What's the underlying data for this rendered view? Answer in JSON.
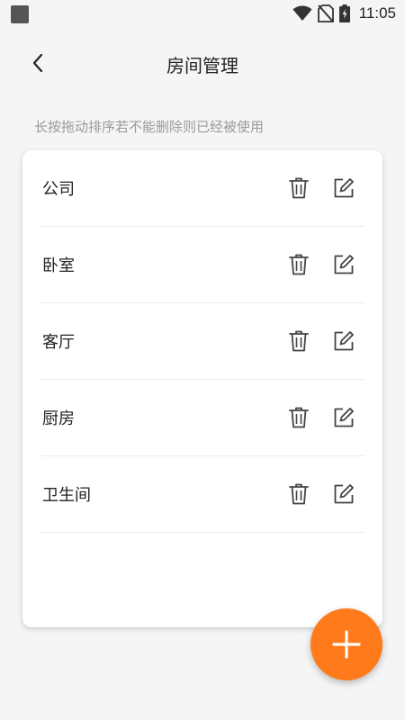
{
  "status_bar": {
    "time": "11:05",
    "icons": [
      "app-notification-icon",
      "wifi-icon",
      "no-sim-icon",
      "battery-charging-icon"
    ]
  },
  "header": {
    "title": "房间管理",
    "back_icon": "chevron-left-icon"
  },
  "hint": "长按拖动排序若不能删除则已经被使用",
  "rooms": [
    {
      "name": "公司"
    },
    {
      "name": "卧室"
    },
    {
      "name": "客厅"
    },
    {
      "name": "厨房"
    },
    {
      "name": "卫生间"
    }
  ],
  "row_actions": [
    "trash-icon",
    "edit-icon"
  ],
  "fab": {
    "icon": "plus-icon"
  },
  "colors": {
    "accent": "#ff7a1a",
    "background": "#f5f5f5",
    "card": "#ffffff",
    "hint_text": "#9a9a9a"
  }
}
